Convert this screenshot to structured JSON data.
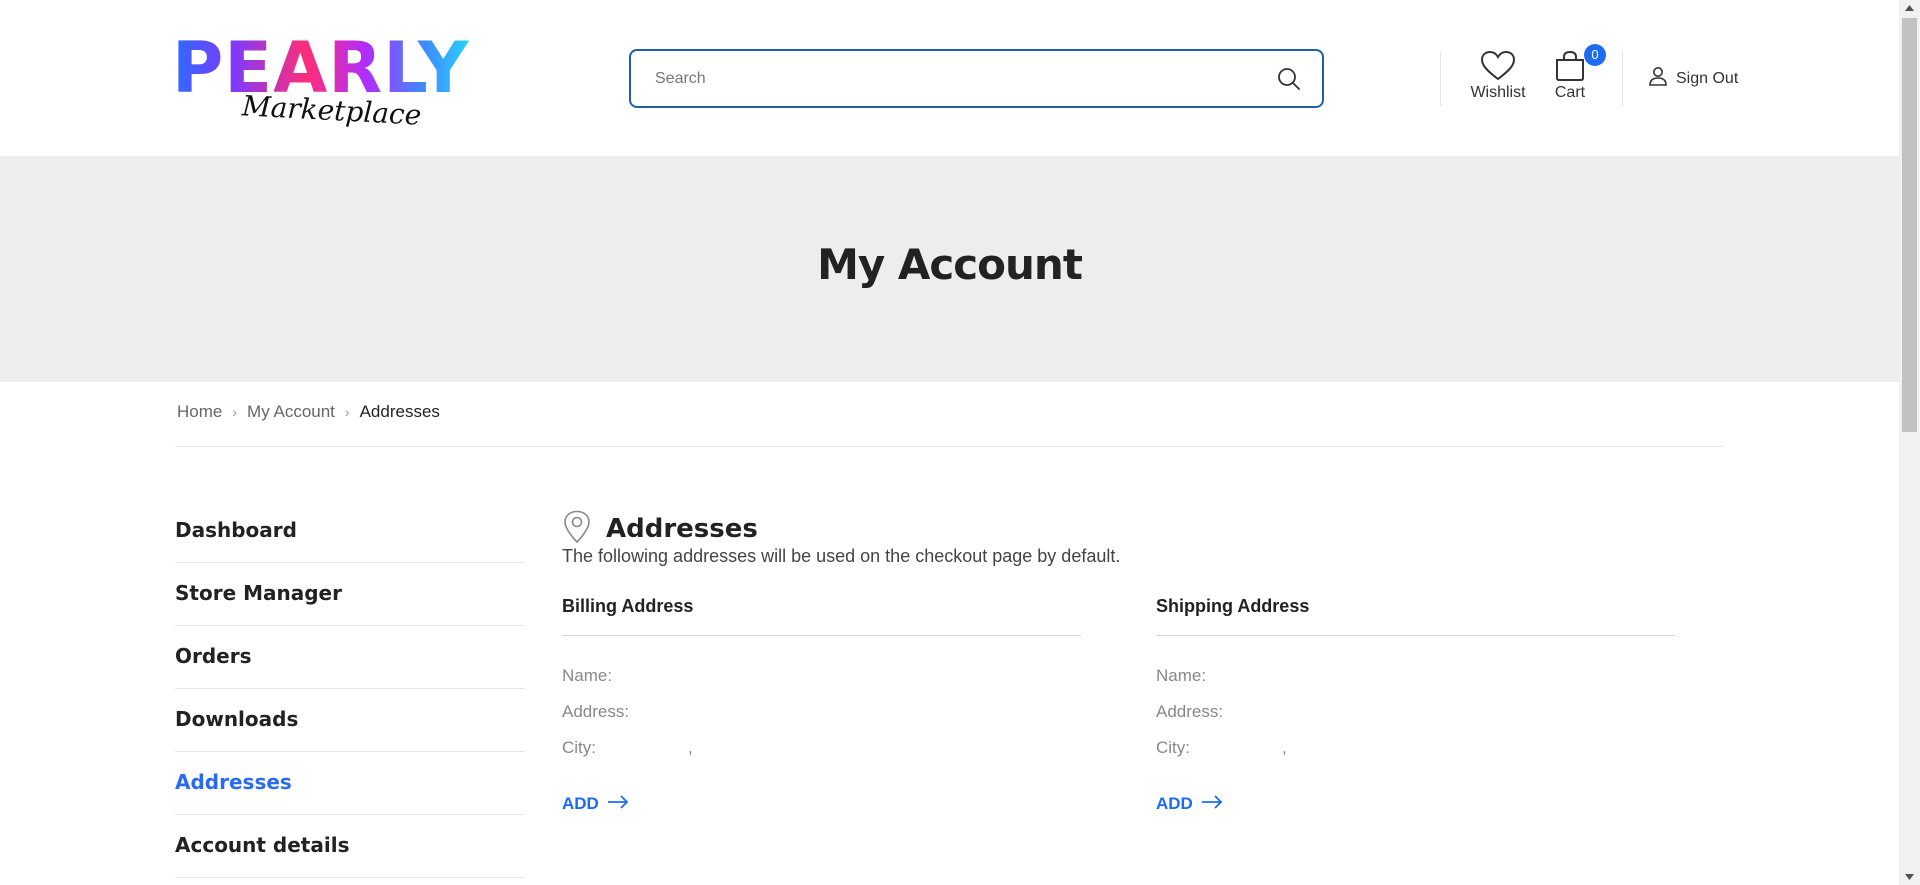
{
  "header": {
    "logo": {
      "word": "PEARLY",
      "sub": "Marketplace"
    },
    "search": {
      "placeholder": "Search"
    },
    "wishlist_label": "Wishlist",
    "cart_label": "Cart",
    "cart_count": "0",
    "signout_label": "Sign Out"
  },
  "banner": {
    "title": "My Account"
  },
  "breadcrumb": {
    "items": [
      "Home",
      "My Account",
      "Addresses"
    ]
  },
  "sidebar": {
    "items": [
      {
        "label": "Dashboard"
      },
      {
        "label": "Store Manager"
      },
      {
        "label": "Orders"
      },
      {
        "label": "Downloads"
      },
      {
        "label": "Addresses",
        "active": true
      },
      {
        "label": "Account details"
      }
    ]
  },
  "content": {
    "title": "Addresses",
    "description": "The following addresses will be used on the checkout page by default.",
    "billing": {
      "title": "Billing Address",
      "name_label": "Name:",
      "address_label": "Address:",
      "city_label": "City:",
      "city_sep": ",",
      "add_label": "ADD"
    },
    "shipping": {
      "title": "Shipping Address",
      "name_label": "Name:",
      "address_label": "Address:",
      "city_label": "City:",
      "city_sep": ",",
      "add_label": "ADD"
    }
  },
  "colors": {
    "accent": "#1d6cf0",
    "search_border": "#1e5fa8",
    "banner_bg": "#ededed"
  },
  "icons": [
    "search-icon",
    "heart-icon",
    "bag-icon",
    "user-icon",
    "map-pin-icon",
    "arrow-right-icon"
  ]
}
